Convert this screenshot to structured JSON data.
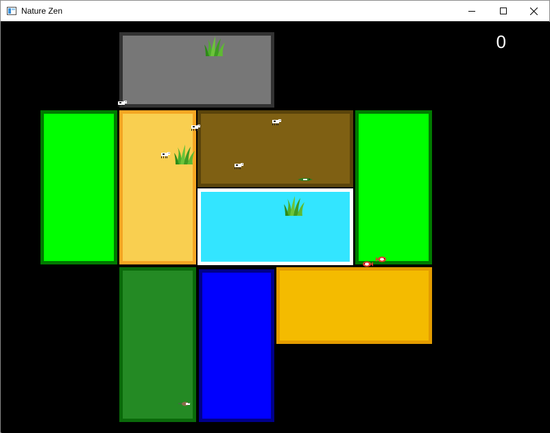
{
  "window": {
    "title": "Nature Zen",
    "controls": [
      {
        "name": "minimize-button",
        "icon": "minimize-icon"
      },
      {
        "name": "maximize-button",
        "icon": "maximize-icon"
      },
      {
        "name": "close-button",
        "icon": "close-icon"
      }
    ]
  },
  "game": {
    "score": "0",
    "background": "#000000",
    "tiles": [
      {
        "id": "gray-plot",
        "fill": "#777777",
        "border": "#333333"
      },
      {
        "id": "lime-meadow-left",
        "fill": "#00FF00",
        "border": "#007A00"
      },
      {
        "id": "sand-field",
        "fill": "#F9CF50",
        "border": "#F5A623"
      },
      {
        "id": "brown-mud",
        "fill": "#7F6013",
        "border": "#5A440B"
      },
      {
        "id": "lime-meadow-right",
        "fill": "#00FF00",
        "border": "#007A00"
      },
      {
        "id": "cyan-pond",
        "fill": "#33E5FF",
        "border": "#FFFFFF"
      },
      {
        "id": "forest-green",
        "fill": "#248A24",
        "border": "#0A6A0A"
      },
      {
        "id": "deep-blue-water",
        "fill": "#0000FF",
        "border": "#00008A"
      },
      {
        "id": "gold-field",
        "fill": "#F4BB00",
        "border": "#E39C00"
      }
    ],
    "sprites": {
      "grass": "grass-tuft-icon",
      "cow": "cow-icon",
      "fish": "fish-icon",
      "crocodile": "crocodile-icon",
      "mouse": "mouse-icon"
    }
  }
}
